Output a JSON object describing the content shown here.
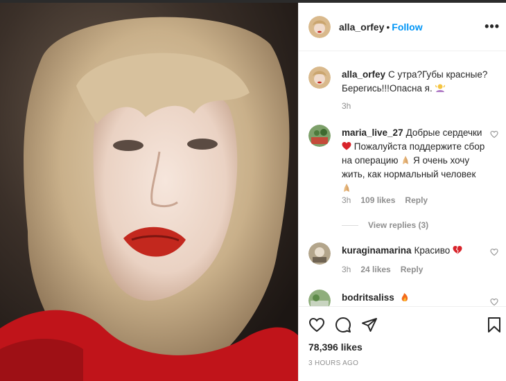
{
  "colors": {
    "accent": "#0095f6",
    "text": "#262626",
    "muted": "#8e8e8e",
    "heart_red": "#ed4956"
  },
  "post": {
    "author": "alla_orfey",
    "separator": "•",
    "follow_label": "Follow",
    "more_icon": "more-options-icon",
    "caption_text": "С утра?Губы красные? Берегись!!!Опасна я.",
    "caption_time": "3h"
  },
  "comments": [
    {
      "user": "maria_live_27",
      "text_1": "Добрые сердечки",
      "text_2": "Пожалуйста поддержите сбор на операцию",
      "text_3": "Я очень хочу жить, как нормальный человек",
      "time": "3h",
      "likes": "109 likes",
      "reply": "Reply",
      "view_replies": "View replies (3)"
    },
    {
      "user": "kuraginamarina",
      "text": "Красиво",
      "time": "3h",
      "likes": "24 likes",
      "reply": "Reply"
    },
    {
      "user": "bodritsaliss",
      "text": ""
    }
  ],
  "actions": {
    "like_icon": "heart-icon",
    "comment_icon": "comment-icon",
    "share_icon": "share-icon",
    "save_icon": "bookmark-icon",
    "likes_count": "78,396 likes",
    "posted_time": "3 HOURS AGO"
  }
}
